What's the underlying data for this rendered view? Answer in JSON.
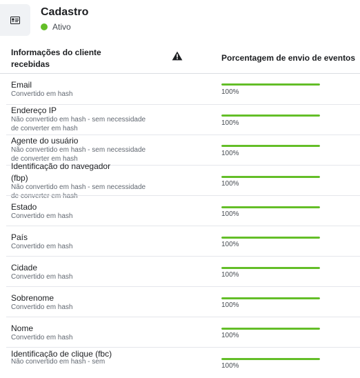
{
  "header": {
    "title": "Cadastro",
    "status_label": "Ativo",
    "status_color": "#63be27",
    "icon": "id-card-icon"
  },
  "table": {
    "col1_header": "Informações do cliente recebidas",
    "warning_icon": "warning-icon",
    "col2_header": "Porcentagem de envio de eventos",
    "rows": [
      {
        "label": "Email",
        "sub": "Convertido em hash",
        "pct_label": "100%",
        "pct": 1.0
      },
      {
        "label": "Endereço IP",
        "sub": "Não convertido em hash - sem necessidade de converter em hash",
        "pct_label": "100%",
        "pct": 1.0
      },
      {
        "label": "Agente do usuário",
        "sub": "Não convertido em hash - sem necessidade de converter em hash",
        "pct_label": "100%",
        "pct": 1.0
      },
      {
        "label": "Identificação do navegador (fbp)",
        "sub": "Não convertido em hash - sem necessidade de converter em hash",
        "pct_label": "100%",
        "pct": 1.0
      },
      {
        "label": "Estado",
        "sub": "Convertido em hash",
        "pct_label": "100%",
        "pct": 1.0
      },
      {
        "label": "País",
        "sub": "Convertido em hash",
        "pct_label": "100%",
        "pct": 1.0
      },
      {
        "label": "Cidade",
        "sub": "Convertido em hash",
        "pct_label": "100%",
        "pct": 1.0
      },
      {
        "label": "Sobrenome",
        "sub": "Convertido em hash",
        "pct_label": "100%",
        "pct": 1.0
      },
      {
        "label": "Nome",
        "sub": "Convertido em hash",
        "pct_label": "100%",
        "pct": 1.0
      },
      {
        "label": "Identificação de clique (fbc)",
        "sub": "Não convertido em hash - sem",
        "pct_label": "100%",
        "pct": 1.0
      }
    ]
  }
}
